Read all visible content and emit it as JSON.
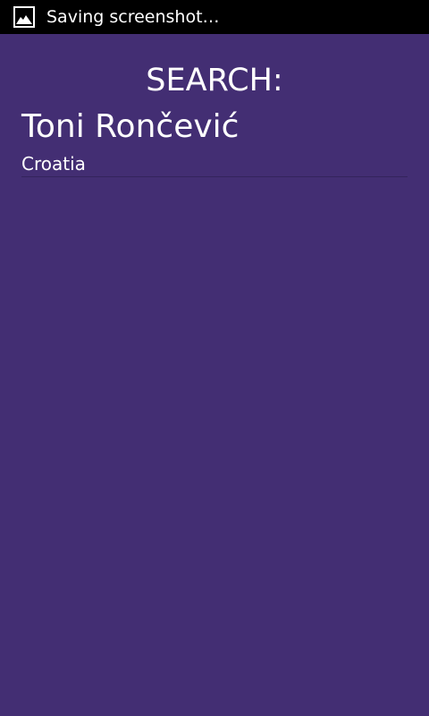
{
  "status_bar": {
    "notification_icon": "image-icon",
    "text": "Saving screenshot…",
    "background": "#000000"
  },
  "main": {
    "background": "#432e73",
    "title": "SEARCH:",
    "results": [
      {
        "name": "Toni Rončević",
        "country": "Croatia"
      }
    ]
  }
}
